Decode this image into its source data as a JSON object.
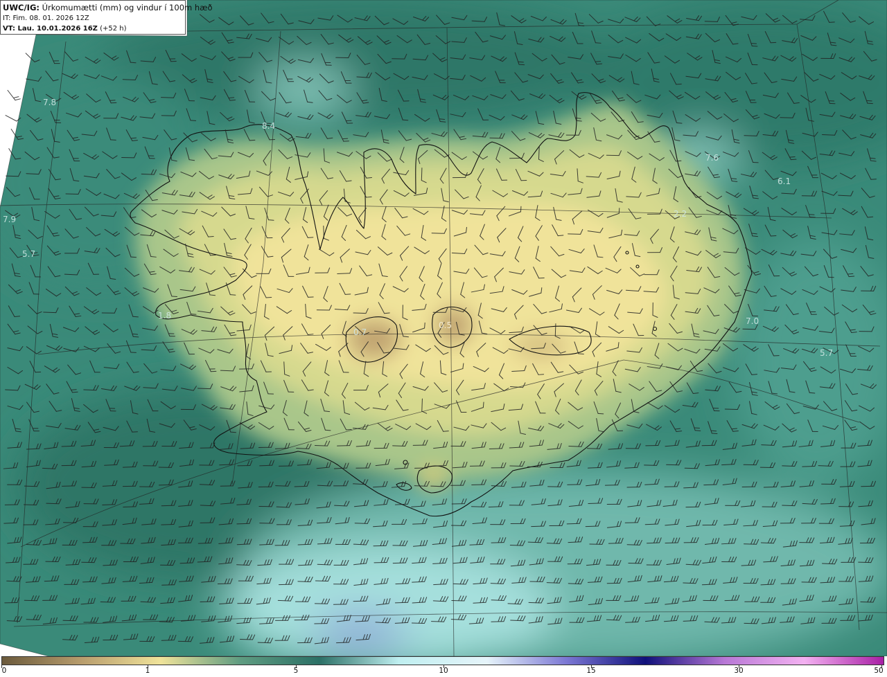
{
  "header": {
    "model": "UWC/IG:",
    "title": "Úrkomumætti (mm) og vindur í 100m hæð",
    "init_time": "IT: Fim. 08. 01. 2026 12Z",
    "valid_label": "VT: Lau. 10.01.2026 16Z",
    "valid_offset": "(+52 h)"
  },
  "map_labels": [
    {
      "text": "7.8"
    },
    {
      "text": "8.4"
    },
    {
      "text": "7.9"
    },
    {
      "text": "5.7"
    },
    {
      "text": "1.8"
    },
    {
      "text": "0.7"
    },
    {
      "text": "0.5"
    },
    {
      "text": "7.6"
    },
    {
      "text": "6.1"
    },
    {
      "text": "2.2"
    },
    {
      "text": "7.0"
    },
    {
      "text": "5.7"
    }
  ],
  "colorbar": {
    "ticks": [
      "0",
      "1",
      "5",
      "10",
      "15",
      "30",
      "50"
    ],
    "colors": [
      "#6b5a3c",
      "#b89d6d",
      "#f0e39a",
      "#5f9c81",
      "#2c7066",
      "#bfeff0",
      "#e6f4fa",
      "#7c78d4",
      "#10107a",
      "#b878d6",
      "#f3b1f1",
      "#a81fa5"
    ]
  }
}
